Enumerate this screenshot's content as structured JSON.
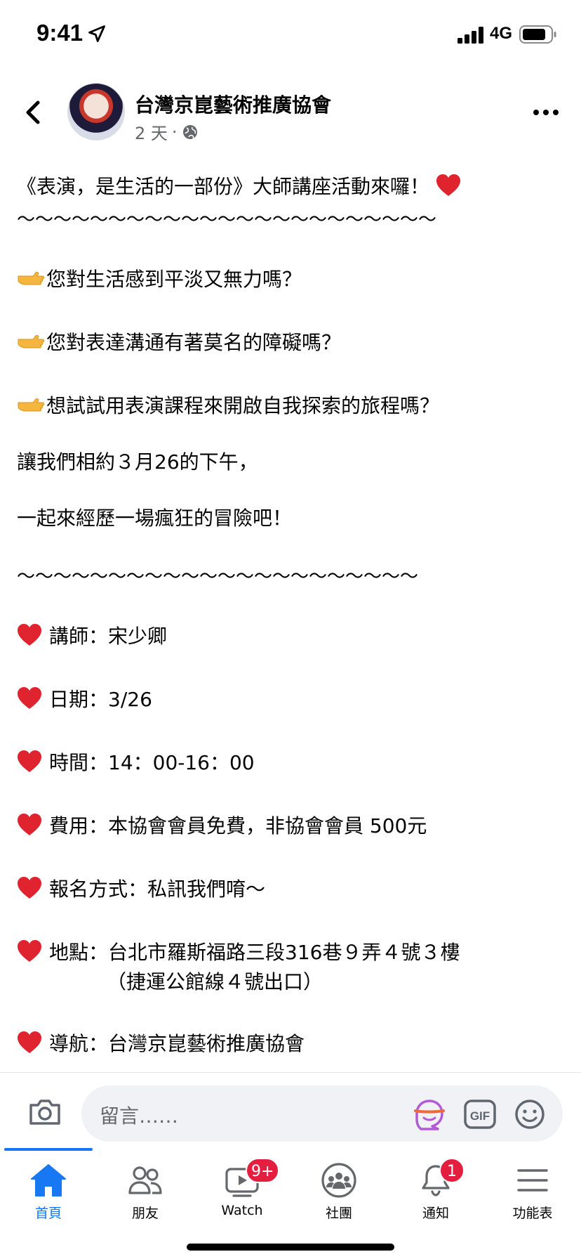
{
  "status_bar": {
    "time": "9:41",
    "network": "4G"
  },
  "post": {
    "page_name": "台灣京崑藝術推廣協會",
    "timestamp": "2 天",
    "separator": "·",
    "title": "《表演，是生活的一部份》大師講座活動來囉！",
    "divider1": "～～～～～～～～～～～～～～～～～～～～～～～",
    "questions": [
      "您對生活感到平淡又無力嗎？",
      "您對表達溝通有著莫名的障礙嗎？",
      "想試試用表演課程來開啟自我探索的旅程嗎？"
    ],
    "invite1": "讓我們相約３月26的下午，",
    "invite2": "一起來經歷一場瘋狂的冒險吧！",
    "divider2": "～～～～～～～～～～～～～～～～～～～～～～",
    "details": [
      "講師：宋少卿",
      "日期：3/26",
      "時間：14：00-16：00",
      "費用：本協會會員免費，非協會會員 500元",
      "報名方式：私訊我們唷～",
      "地點：台北市羅斯福路三段316巷９弄４號３樓",
      "導航：台灣京崑藝術推廣協會"
    ],
    "location_note": "（捷運公館線４號出口）"
  },
  "comment_bar": {
    "placeholder": "留言……"
  },
  "tabs": [
    {
      "label": "首頁",
      "icon": "home-icon",
      "active": true
    },
    {
      "label": "朋友",
      "icon": "friends-icon"
    },
    {
      "label": "Watch",
      "icon": "watch-icon",
      "badge": "9+"
    },
    {
      "label": "社團",
      "icon": "groups-icon"
    },
    {
      "label": "通知",
      "icon": "bell-icon",
      "badge": "1"
    },
    {
      "label": "功能表",
      "icon": "menu-icon"
    }
  ],
  "colors": {
    "accent": "#1877f2",
    "badge": "#e41e3f",
    "heart": "#e0242f",
    "secondary_text": "#65676b"
  }
}
